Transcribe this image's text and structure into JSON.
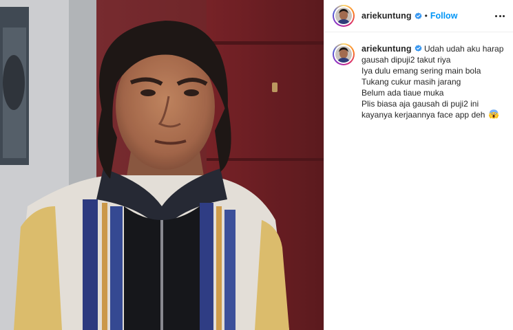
{
  "post": {
    "header": {
      "username": "ariekuntung",
      "separator": "•",
      "follow_label": "Follow",
      "verified_icon": "verified-badge-icon",
      "more_icon": "more-options-icon"
    },
    "caption": {
      "username": "ariekuntung",
      "lines": [
        "Udah udah aku harap",
        "gausah dipuji2 takut riya",
        "Iya dulu emang sering main bola",
        "Tukang cukur masih jarang",
        "Belum ada tiaue muka",
        "Plis biasa aja gausah di puji2 ini",
        "kayanya kerjaannya face app deh"
      ],
      "emoji": "face-screaming-emoji"
    }
  },
  "colors": {
    "link_blue": "#0095f6",
    "verified_blue": "#3897f0",
    "text": "#262626",
    "border": "#efefef"
  }
}
